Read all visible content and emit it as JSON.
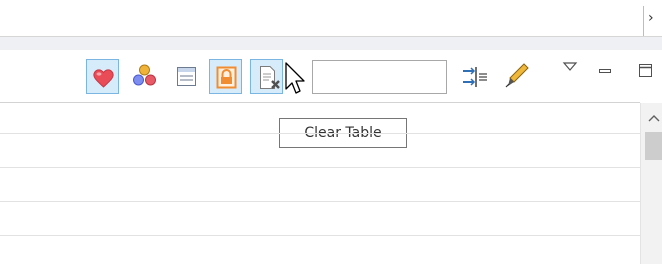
{
  "toolbar": {
    "buttons": [
      {
        "icon": "heart-icon",
        "toggled": true
      },
      {
        "icon": "color-balls-icon",
        "toggled": false
      },
      {
        "icon": "details-panel-icon",
        "toggled": false
      },
      {
        "icon": "lock-icon",
        "toggled": true
      },
      {
        "icon": "clear-table-icon",
        "toggled": true
      }
    ],
    "filter_value": "",
    "tools": [
      "insert-separator-icon",
      "pen-icon"
    ],
    "view_menu": [
      "view-menu-icon",
      "minimize-icon",
      "maximize-icon"
    ]
  },
  "top_strip": {
    "chevron": "›"
  },
  "tooltip": {
    "text": "Clear Table"
  },
  "colors": {
    "toggled_bg": "#d7ecfa",
    "toggled_border": "#7ab6e1",
    "heart": "#e94b57",
    "lock": "#f08c32"
  }
}
